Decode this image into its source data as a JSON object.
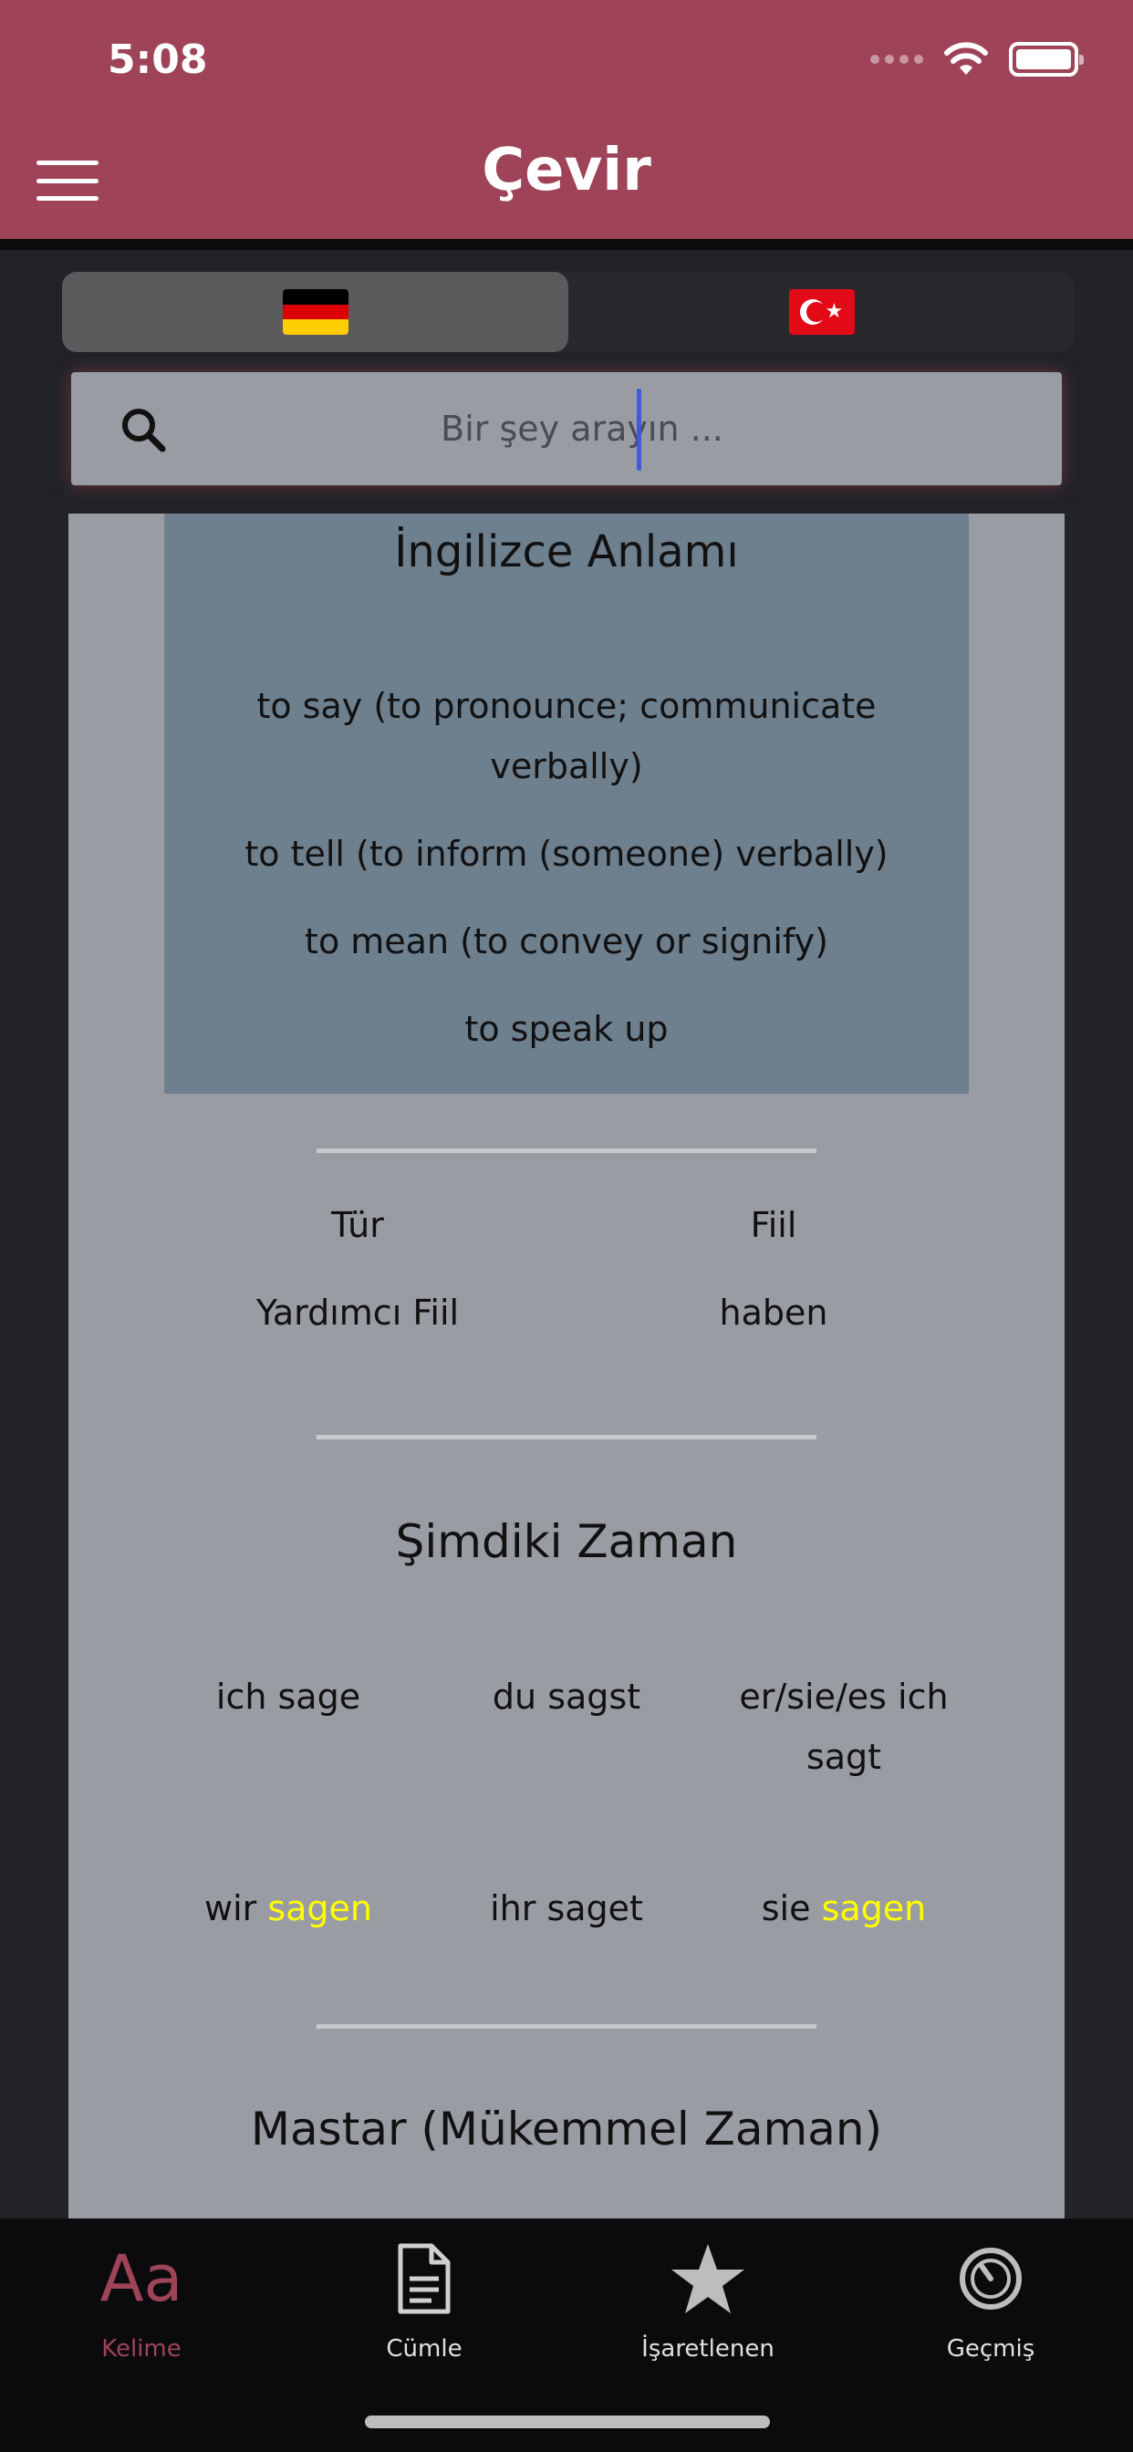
{
  "status_bar": {
    "time": "5:08"
  },
  "header": {
    "title": "Çevir"
  },
  "lang_toggle": {
    "source": "German",
    "target": "Turkish"
  },
  "search": {
    "placeholder": "Bir şey arayın ...",
    "value": ""
  },
  "meaning": {
    "title": "İngilizce Anlamı",
    "items": [
      "to say (to pronounce; communicate verbally)",
      "to tell (to inform (someone) verbally)",
      "to mean (to convey or signify)",
      "to speak up"
    ]
  },
  "info": {
    "type_label": "Tür",
    "type_value": "Fiil",
    "aux_label": "Yardımcı Fiil",
    "aux_value": "haben"
  },
  "present": {
    "title": "Şimdiki Zaman",
    "row1": [
      "ich sage",
      "du sagst",
      "er/sie/es ich sagt"
    ],
    "row2": [
      {
        "pronoun": "wir",
        "verb": "sagen"
      },
      {
        "pronoun": "ihr",
        "verb": "saget"
      },
      {
        "pronoun": "sie",
        "verb": "sagen"
      }
    ]
  },
  "perfect": {
    "title": "Mastar (Mükemmel Zaman)"
  },
  "tabs": [
    {
      "label": "Kelime",
      "icon": "aa-icon"
    },
    {
      "label": "Cümle",
      "icon": "document-icon"
    },
    {
      "label": "İşaretlenen",
      "icon": "star-icon"
    },
    {
      "label": "Geçmiş",
      "icon": "history-icon"
    }
  ],
  "colors": {
    "accent": "#9e4358",
    "highlight": "#ffff00"
  }
}
